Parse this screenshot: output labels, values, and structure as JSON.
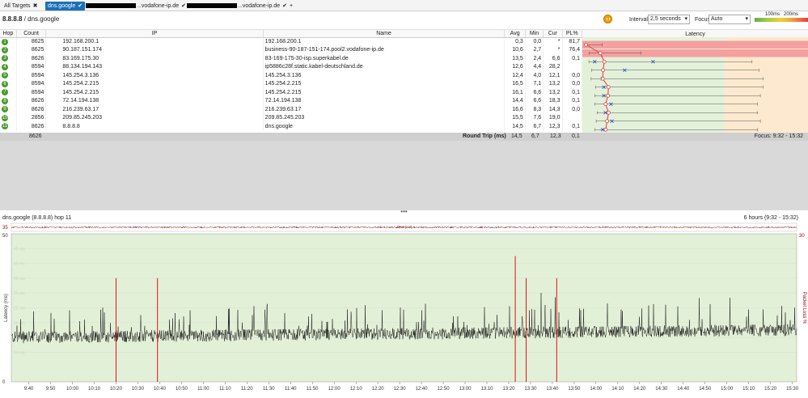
{
  "tabs": [
    {
      "label": "All Targets",
      "close": "✖",
      "active": false
    },
    {
      "label": "dns.google",
      "close": "✔",
      "active": true
    },
    {
      "label": "...vodafone-ip.de",
      "close": "✔",
      "active": false,
      "redacted": true
    },
    {
      "label": "...vodafone-ip.de",
      "close": "✔",
      "active": false,
      "redacted": true
    },
    {
      "label": "+",
      "close": "",
      "active": false
    }
  ],
  "target": {
    "ip": "8.8.8.8",
    "name": "dns.google"
  },
  "toolbar": {
    "interval_label": "Interval",
    "interval_value": "2,5 seconds",
    "focus_label": "Focus",
    "focus_value": "Auto",
    "legend_100": "100ms",
    "legend_200": "200ms"
  },
  "columns": [
    "Hop",
    "Count",
    "IP",
    "Name",
    "Avg",
    "Min",
    "Cur",
    "PL%",
    "Latency"
  ],
  "latency_scale": {
    "left": "0 ms",
    "right": "158 ms"
  },
  "hops": [
    {
      "hop": "1",
      "count": "8625",
      "ip": "192.168.200.1",
      "name": "192.168.200.1",
      "avg": "0,3",
      "min": "0,0",
      "cur": "*",
      "pl": "81,7",
      "plv": 81.7,
      "avgv": 0.3,
      "minv": 0,
      "maxv": 12,
      "curv": null
    },
    {
      "hop": "2",
      "count": "8625",
      "ip": "90.187.151.174",
      "name": "business-90-187-151-174.pool2.vodafone-ip.de",
      "avg": "10,6",
      "min": "2,7",
      "cur": "*",
      "pl": "76,4",
      "plv": 76.4,
      "avgv": 10.6,
      "minv": 2.7,
      "maxv": 40,
      "curv": null
    },
    {
      "hop": "3",
      "count": "8626",
      "ip": "83.169.175.30",
      "name": "83-169-175-30-isp.superkabel.de",
      "avg": "13,5",
      "min": "2,4",
      "cur": "6,6",
      "pl": "0,1",
      "plv": 0.1,
      "avgv": 13.5,
      "minv": 2.4,
      "maxv": 120,
      "curv": 6.6,
      "spike": 27
    },
    {
      "hop": "4",
      "count": "8594",
      "ip": "88.134.194.143",
      "name": "ip5886c28f.static.kabel-deutschland.de",
      "avg": "12,6",
      "min": "4,4",
      "cur": "28,2",
      "pl": "",
      "plv": 0,
      "avgv": 12.6,
      "minv": 4.4,
      "maxv": 125,
      "curv": 28.2
    },
    {
      "hop": "5",
      "count": "8594",
      "ip": "145.254.3.136",
      "name": "145.254.3.136",
      "avg": "12,4",
      "min": "4,0",
      "cur": "12,1",
      "pl": "0,0",
      "plv": 0,
      "avgv": 12.4,
      "minv": 4.0,
      "maxv": 128,
      "curv": 12.1
    },
    {
      "hop": "6",
      "count": "8594",
      "ip": "145.254.2.215",
      "name": "145.254.2.215",
      "avg": "16,5",
      "min": "7,1",
      "cur": "13,2",
      "pl": "0,0",
      "plv": 0,
      "avgv": 16.5,
      "minv": 7.1,
      "maxv": 128,
      "curv": 13.2
    },
    {
      "hop": "7",
      "count": "8594",
      "ip": "145.254.2.215",
      "name": "145.254.2.215",
      "avg": "16,1",
      "min": "6,6",
      "cur": "13,2",
      "pl": "0,1",
      "plv": 0.1,
      "avgv": 16.1,
      "minv": 6.6,
      "maxv": 126,
      "curv": 13.2
    },
    {
      "hop": "8",
      "count": "8626",
      "ip": "72.14.194.138",
      "name": "72.14.194.138",
      "avg": "14,4",
      "min": "6,6",
      "cur": "18,3",
      "pl": "0,1",
      "plv": 0.1,
      "avgv": 14.4,
      "minv": 6.6,
      "maxv": 124,
      "curv": 18.3
    },
    {
      "hop": "9",
      "count": "8626",
      "ip": "216.239.63.17",
      "name": "216.239.63.17",
      "avg": "16,6",
      "min": "8,3",
      "cur": "14,3",
      "pl": "0,0",
      "plv": 0,
      "avgv": 16.6,
      "minv": 8.3,
      "maxv": 124,
      "curv": 14.3
    },
    {
      "hop": "10",
      "count": "2856",
      "ip": "209.85.245.203",
      "name": "209.85.245.203",
      "avg": "15,5",
      "min": "7,6",
      "cur": "19,0",
      "pl": "",
      "plv": 0,
      "avgv": 15.5,
      "minv": 7.6,
      "maxv": 126,
      "curv": 19.0
    },
    {
      "hop": "11",
      "count": "8626",
      "ip": "8.8.8.8",
      "name": "dns.google",
      "avg": "14,5",
      "min": "6,7",
      "cur": "12,3",
      "pl": "0,1",
      "plv": 0.1,
      "avgv": 14.5,
      "minv": 6.7,
      "maxv": 124,
      "curv": 12.3
    }
  ],
  "summary": {
    "count": "8626",
    "label": "Round Trip (ms)",
    "avg": "14,5",
    "min": "6,7",
    "cur": "12,3",
    "pl": "0,1",
    "focus": "Focus: 9:32 - 15:32"
  },
  "bottom": {
    "title": "dns.google (8.8.8.8) hop 11",
    "range": "6 hours (9:32 - 15:32)"
  },
  "chart_data": {
    "type": "line",
    "ylabel": "Latency (ms)",
    "y2label": "Packet Loss %",
    "jitter_label": "Jitter (ms)",
    "jitter_max": "35",
    "ylim": [
      0,
      50
    ],
    "ytick_labels": [
      "0",
      "50"
    ],
    "y2_top": "30",
    "yticks_faint": [
      10,
      15,
      20,
      25,
      30,
      35,
      40,
      45
    ],
    "x_labels": [
      "9:40",
      "9:50",
      "10:00",
      "10:10",
      "10:20",
      "10:30",
      "10:40",
      "10:50",
      "11:00",
      "11:10",
      "11:20",
      "11:30",
      "11:40",
      "11:50",
      "12:00",
      "12:10",
      "12:20",
      "12:30",
      "12:40",
      "12:50",
      "13:00",
      "13:10",
      "13:20",
      "13:30",
      "13:40",
      "13:50",
      "14:00",
      "14:10",
      "14:20",
      "14:30",
      "14:40",
      "14:50",
      "15:00",
      "15:10",
      "15:20",
      "15:30"
    ],
    "xstart_min": 572,
    "xend_min": 932,
    "baseline_ms": 15,
    "loss_events_min": [
      620,
      639,
      803,
      808,
      822
    ],
    "loss_heights_pct": [
      0.7,
      0.7,
      0.85,
      0.7,
      0.7
    ]
  }
}
